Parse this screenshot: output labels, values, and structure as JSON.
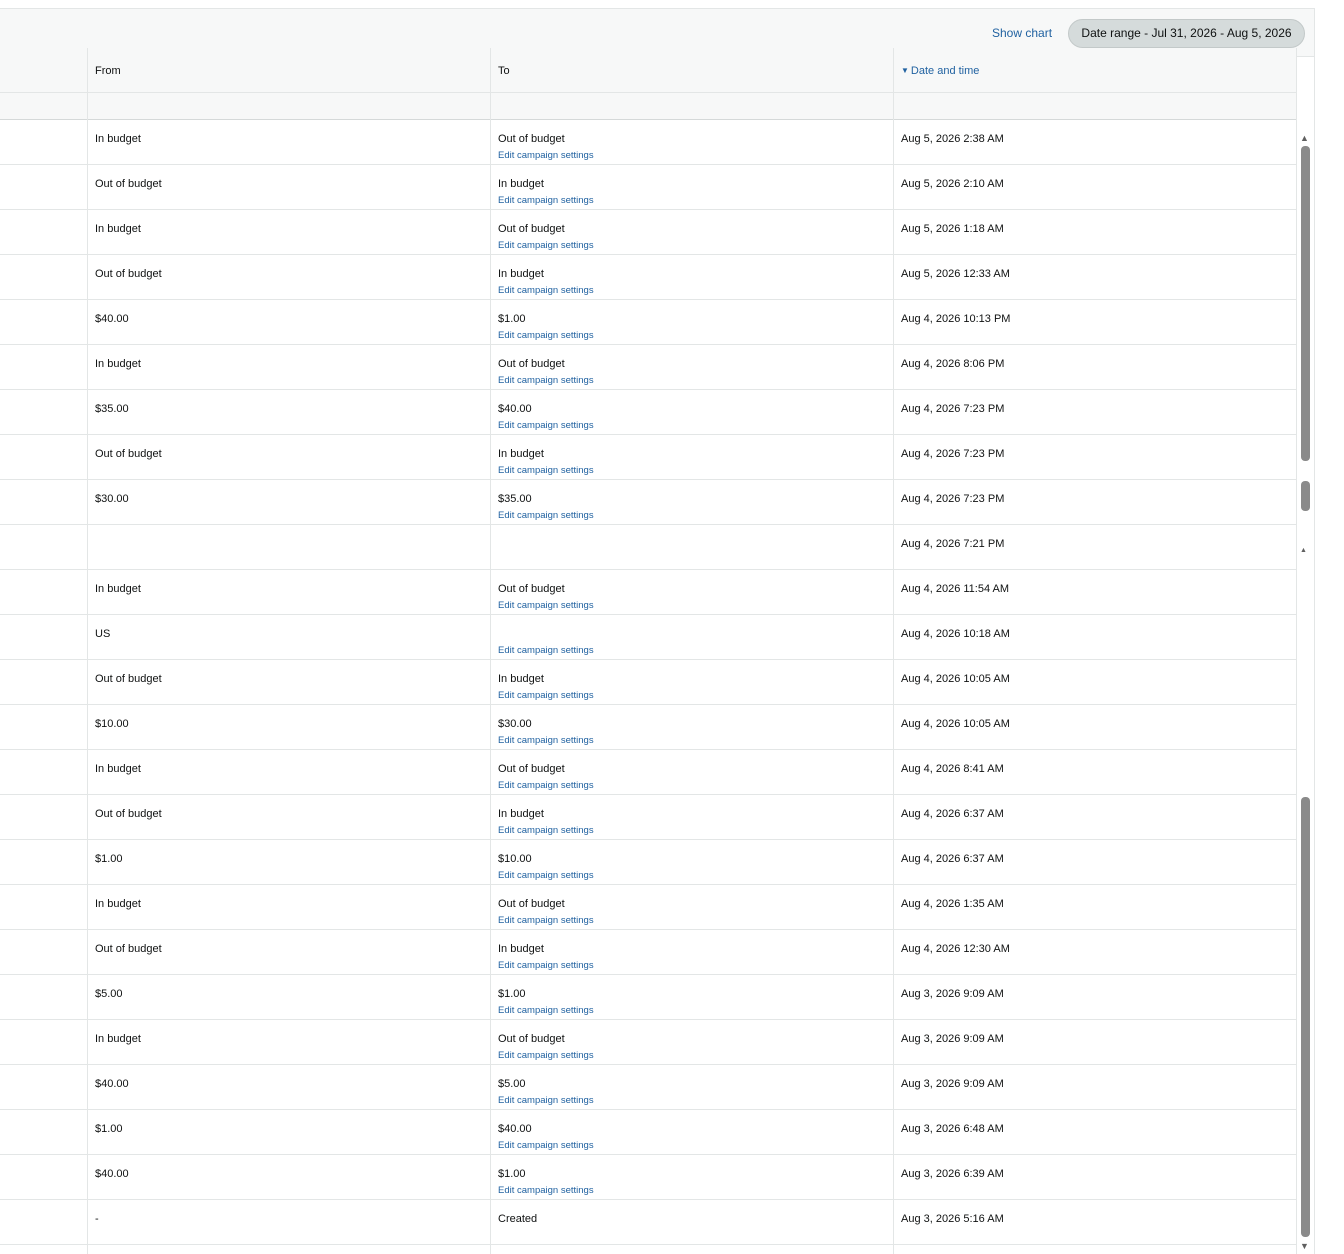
{
  "toolbar": {
    "show_chart": "Show chart",
    "date_range": "Date range - Jul 31, 2026 - Aug 5, 2026"
  },
  "columns": {
    "from": "From",
    "to": "To",
    "date": "Date and time"
  },
  "edit_link_label": "Edit campaign settings",
  "rows": [
    {
      "from": "In budget",
      "to": "Out of budget",
      "date": "Aug 5, 2026 2:38 AM",
      "link": "Edit campaign settings"
    },
    {
      "from": "Out of budget",
      "to": "In budget",
      "date": "Aug 5, 2026 2:10 AM",
      "link": "Edit campaign settings"
    },
    {
      "from": "In budget",
      "to": "Out of budget",
      "date": "Aug 5, 2026 1:18 AM",
      "link": "Edit campaign settings"
    },
    {
      "from": "Out of budget",
      "to": "In budget",
      "date": "Aug 5, 2026 12:33 AM",
      "link": "Edit campaign settings"
    },
    {
      "from": "$40.00",
      "to": "$1.00",
      "date": "Aug 4, 2026 10:13 PM",
      "link": "Edit campaign settings"
    },
    {
      "from": "In budget",
      "to": "Out of budget",
      "date": "Aug 4, 2026 8:06 PM",
      "link": "Edit campaign settings"
    },
    {
      "from": "$35.00",
      "to": "$40.00",
      "date": "Aug 4, 2026 7:23 PM",
      "link": "Edit campaign settings"
    },
    {
      "from": "Out of budget",
      "to": "In budget",
      "date": "Aug 4, 2026 7:23 PM",
      "link": "Edit campaign settings"
    },
    {
      "from": "$30.00",
      "to": "$35.00",
      "date": "Aug 4, 2026 7:23 PM",
      "link": "Edit campaign settings"
    },
    {
      "from": "",
      "to": "",
      "date": "Aug 4, 2026 7:21 PM",
      "link": ""
    },
    {
      "from": "In budget",
      "to": "Out of budget",
      "date": "Aug 4, 2026 11:54 AM",
      "link": "Edit campaign settings"
    },
    {
      "from": "US",
      "to": "",
      "date": "Aug 4, 2026 10:18 AM",
      "link": "Edit campaign settings"
    },
    {
      "from": "Out of budget",
      "to": "In budget",
      "date": "Aug 4, 2026 10:05 AM",
      "link": "Edit campaign settings"
    },
    {
      "from": "$10.00",
      "to": "$30.00",
      "date": "Aug 4, 2026 10:05 AM",
      "link": "Edit campaign settings"
    },
    {
      "from": "In budget",
      "to": "Out of budget",
      "date": "Aug 4, 2026 8:41 AM",
      "link": "Edit campaign settings"
    },
    {
      "from": "Out of budget",
      "to": "In budget",
      "date": "Aug 4, 2026 6:37 AM",
      "link": "Edit campaign settings"
    },
    {
      "from": "$1.00",
      "to": "$10.00",
      "date": "Aug 4, 2026 6:37 AM",
      "link": "Edit campaign settings"
    },
    {
      "from": "In budget",
      "to": "Out of budget",
      "date": "Aug 4, 2026 1:35 AM",
      "link": "Edit campaign settings"
    },
    {
      "from": "Out of budget",
      "to": "In budget",
      "date": "Aug 4, 2026 12:30 AM",
      "link": "Edit campaign settings"
    },
    {
      "from": "$5.00",
      "to": "$1.00",
      "date": "Aug 3, 2026 9:09 AM",
      "link": "Edit campaign settings"
    },
    {
      "from": "In budget",
      "to": "Out of budget",
      "date": "Aug 3, 2026 9:09 AM",
      "link": "Edit campaign settings"
    },
    {
      "from": "$40.00",
      "to": "$5.00",
      "date": "Aug 3, 2026 9:09 AM",
      "link": "Edit campaign settings"
    },
    {
      "from": "$1.00",
      "to": "$40.00",
      "date": "Aug 3, 2026 6:48 AM",
      "link": "Edit campaign settings"
    },
    {
      "from": "$40.00",
      "to": "$1.00",
      "date": "Aug 3, 2026 6:39 AM",
      "link": "Edit campaign settings"
    },
    {
      "from": "-",
      "to": "Created",
      "date": "Aug 3, 2026 5:16 AM",
      "link": ""
    }
  ],
  "colors": {
    "link": "#2162a1",
    "header_bg": "#f7f8f8",
    "pill_bg": "#d5dbdb",
    "border": "#e3e6e6"
  },
  "icons": {
    "sort": "caret-down-icon",
    "scroll_up": "triangle-up-icon",
    "scroll_down": "triangle-down-icon"
  }
}
